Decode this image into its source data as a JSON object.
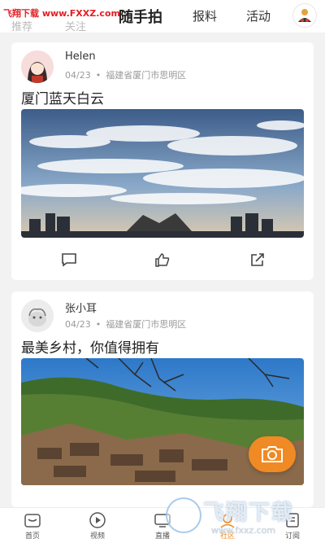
{
  "watermark_top": "飞翔下载 www.FXXZ.com",
  "tabs": [
    {
      "label": "推荐"
    },
    {
      "label": "关注"
    },
    {
      "label": "随手拍",
      "active": true
    },
    {
      "label": "报料"
    },
    {
      "label": "活动"
    }
  ],
  "posts": [
    {
      "author": "Helen",
      "date": "04/23",
      "location": "福建省厦门市思明区",
      "title": "厦门蓝天白云",
      "image": "sky-clouds-city"
    },
    {
      "author": "张小耳",
      "date": "04/23",
      "location": "福建省厦门市思明区",
      "title": "最美乡村，你值得拥有",
      "image": "mountain-village"
    }
  ],
  "actions": [
    "comment-icon",
    "like-icon",
    "share-icon"
  ],
  "camera_icon": "camera-icon",
  "accent_color": "#f08a24",
  "bottom_nav": [
    {
      "label": "首页",
      "icon": "home-icon"
    },
    {
      "label": "视频",
      "icon": "play-icon"
    },
    {
      "label": "直播",
      "icon": "live-icon"
    },
    {
      "label": "社区",
      "icon": "community-icon",
      "active": true
    },
    {
      "label": "订阅",
      "icon": "subscribe-icon"
    }
  ],
  "watermark": {
    "big": "飞翔下载",
    "small": "www.fxxz.com"
  }
}
